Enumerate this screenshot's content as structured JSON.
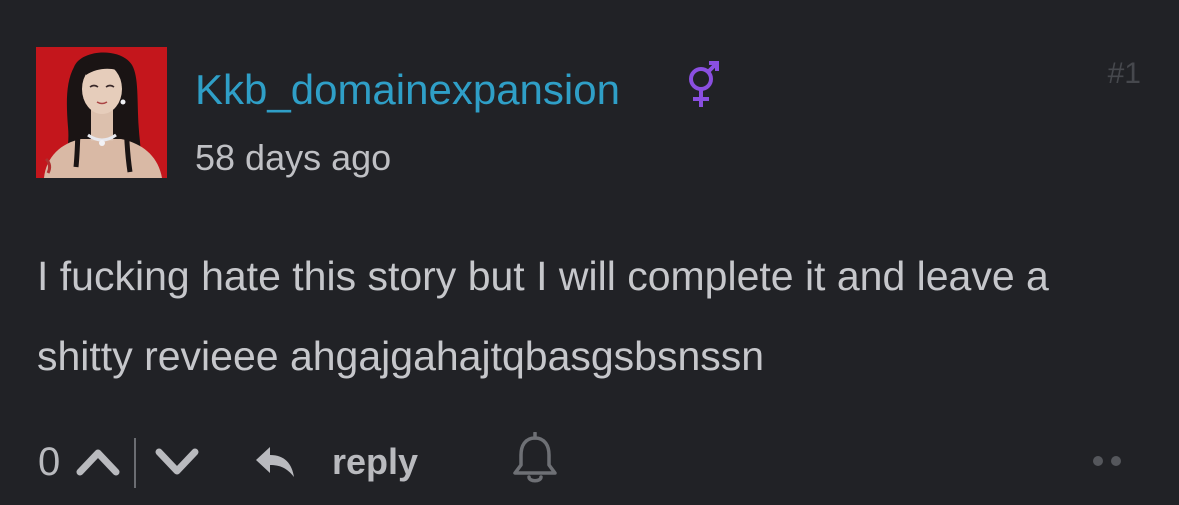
{
  "comment": {
    "username": "Kkb_domainexpansion",
    "gender_symbol": "⚥",
    "timestamp": "58 days ago",
    "post_number": "#1",
    "body": "I fucking hate this story but I will complete it and leave a shitty revieee ahgajgahajtqbasgsbsnssn",
    "votes": "0",
    "reply_label": "reply"
  },
  "icons": {
    "avatar": "avatar-image",
    "gender": "intersex-gender-icon",
    "upvote": "chevron-up-icon",
    "downvote": "chevron-down-icon",
    "reply": "reply-arrow-icon",
    "notify": "bell-icon",
    "more": "more-dots-icon"
  },
  "colors": {
    "background": "#212226",
    "username": "#2f9fc7",
    "gender_icon": "#8a4fe0",
    "text": "#c6c7cb",
    "muted": "#46484d",
    "avatar_bg": "#c4161c"
  }
}
